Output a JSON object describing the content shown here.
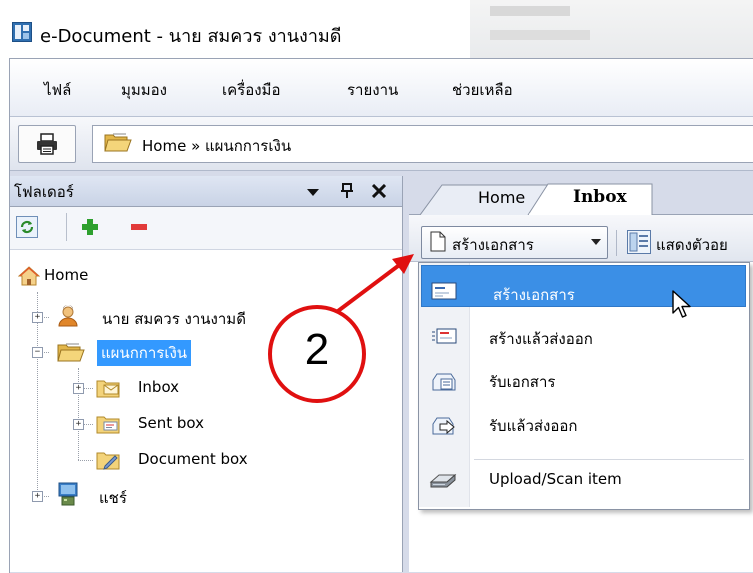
{
  "window": {
    "title": "e-Document - นาย สมควร งานงามดี"
  },
  "menu": {
    "items": [
      "ไฟล์",
      "มุมมอง",
      "เครื่องมือ",
      "รายงาน",
      "ช่วยเหลือ"
    ]
  },
  "toolbar": {
    "breadcrumb": "Home » แผนกการเงิน"
  },
  "folder_pane": {
    "title": "โฟลเดอร์",
    "tree": {
      "home": "Home",
      "user": "นาย สมควร งานงามดี",
      "dept": "แผนกการเงิน",
      "inbox": "Inbox",
      "sent": "Sent box",
      "document": "Document box",
      "share": "แชร์"
    }
  },
  "tabs": {
    "items": [
      "Home",
      "Inbox"
    ],
    "active": "Inbox"
  },
  "content_toolbar": {
    "create_label": "สร้างเอกสาร",
    "view_label": "แสดงตัวอย"
  },
  "dropdown": {
    "items": [
      {
        "label": "สร้างเอกสาร",
        "icon": "new-document-icon",
        "selected": true
      },
      {
        "label": "สร้างแล้วส่งออก",
        "icon": "create-send-icon"
      },
      {
        "label": "รับเอกสาร",
        "icon": "receive-document-icon"
      },
      {
        "label": "รับแล้วส่งออก",
        "icon": "receive-forward-icon"
      },
      {
        "label": "Upload/Scan item",
        "icon": "scanner-icon"
      }
    ]
  },
  "annotation": {
    "step": "2",
    "color": "#e01010"
  },
  "colors": {
    "selection": "#3b8fe6",
    "tree_selection": "#3399ff"
  }
}
